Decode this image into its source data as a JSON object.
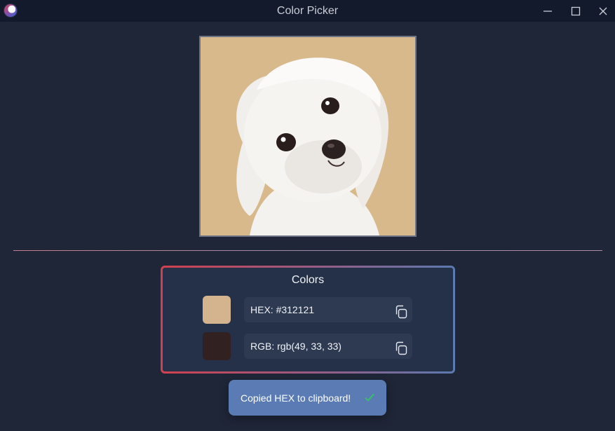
{
  "window": {
    "title": "Color Picker"
  },
  "image": {
    "alt": "White Maltese puppy on tan background"
  },
  "colors_panel": {
    "title": "Colors",
    "swatch_primary": "#d3b48e",
    "swatch_secondary": "#312121",
    "hex_label": "HEX: #312121",
    "rgb_label": "RGB: rgb(49, 33, 33)"
  },
  "toast": {
    "message": "Copied HEX to clipboard!"
  },
  "icons": {
    "app": "app-logo-icon",
    "minimize": "minimize-icon",
    "maximize": "maximize-icon",
    "close": "close-icon",
    "copy": "copy-icon",
    "check": "check-icon"
  }
}
